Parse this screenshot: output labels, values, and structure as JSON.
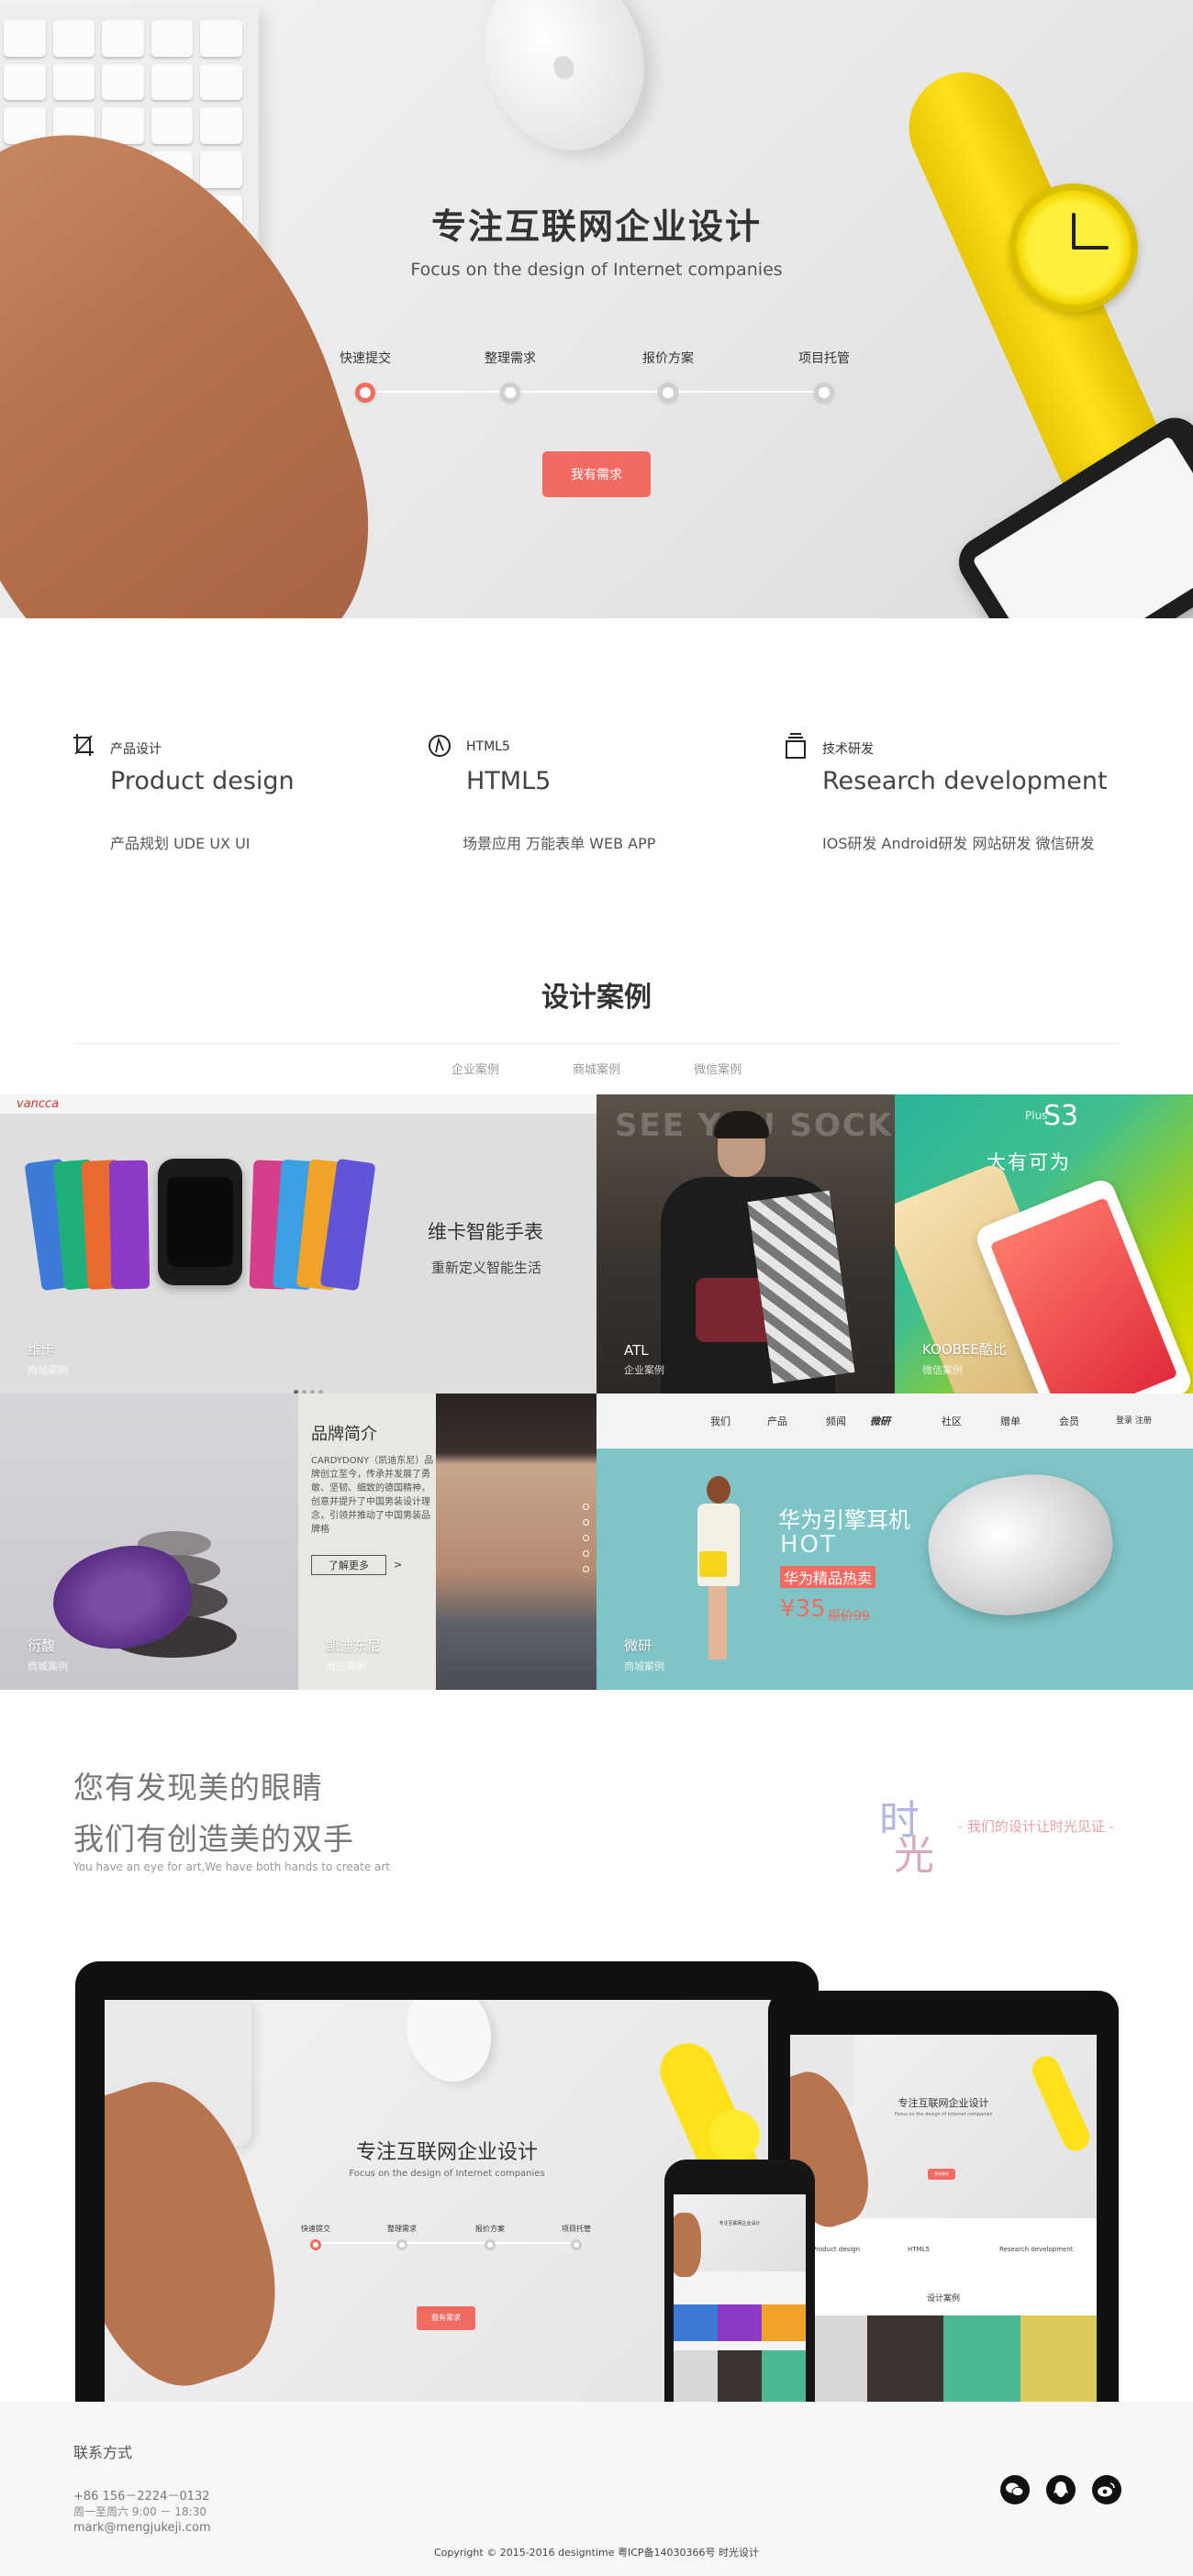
{
  "hero": {
    "title": "专注互联网企业设计",
    "subtitle": "Focus on the design of Internet companies",
    "steps": [
      "快速提交",
      "整理需求",
      "报价方案",
      "项目托管"
    ],
    "active_step": 1,
    "cta": "我有需求"
  },
  "services": [
    {
      "tag": "产品设计",
      "title": "Product design",
      "desc": "产品规划 UDE UX UI",
      "icon": "crop-icon"
    },
    {
      "tag": "HTML5",
      "title": "HTML5",
      "desc": "场景应用 万能表单 WEB APP",
      "icon": "compass-icon"
    },
    {
      "tag": "技术研发",
      "title": "Research development",
      "desc": "IOS研发 Android研发 网站研发 微信研发",
      "icon": "stack-icon"
    }
  ],
  "cases": {
    "title": "设计案例",
    "tabs": [
      "企业案例",
      "商城案例",
      "微信案例"
    ],
    "items": [
      {
        "name": "维卡",
        "category": "商城案例",
        "brand": "vancca",
        "headline": "维卡智能手表",
        "tagline": "重新定义智能生活"
      },
      {
        "name": "ATL",
        "category": "企业案例",
        "bg_text": "SEE YOU SOCK"
      },
      {
        "name": "KOOBEE酷比",
        "category": "微信案例",
        "plus": "Plus",
        "model": "S3",
        "slogan": "大有可为"
      },
      {
        "name": "衍馥",
        "category": "商城案例"
      },
      {
        "name": "凯迪东尼",
        "category": "微店案例",
        "intro_title": "品牌简介",
        "intro_text": "CARDYDONY（凯迪东尼）品牌创立至今，传承并发展了勇敢、坚韧、细致的德国精神，创意并提升了中国男装设计理念，引领并推动了中国男装品牌格",
        "more": "了解更多",
        "more_arrow": ">"
      },
      {
        "name": "微研",
        "category": "商城案例",
        "logo": "微研",
        "nav": [
          "我们",
          "产品",
          "频闻",
          "社区",
          "赠单",
          "会员",
          "登录 注册"
        ],
        "promo_title": "华为引擎耳机",
        "promo_hot": "HOT",
        "promo_sub": "华为精品热卖",
        "price": "¥35",
        "old_price": "原价99"
      }
    ]
  },
  "discover": {
    "line1": "您有发现美的眼睛",
    "line2": "我们有创造美的双手",
    "line3": "You have an eye for art,We have both hands to create art",
    "brand_c1": "时",
    "brand_c2": "光",
    "slogan": "- 我们的设计让时光见证 -"
  },
  "devices": {
    "title": "专注互联网企业设计",
    "subtitle": "Focus on the design of Internet companies",
    "steps": [
      "快速提交",
      "整理需求",
      "报价方案",
      "项目托管"
    ],
    "cta": "我有需求",
    "tablet_services": [
      "Product design",
      "HTML5",
      "Research development"
    ],
    "tablet_cases": "设计案例"
  },
  "footer": {
    "title": "联系方式",
    "phone": "+86 156－2224－0132",
    "hours": "周一至周六 9:00 － 18:30",
    "email": "mark@mengjukeji.com",
    "copyright": "Copyright © 2015-2016 designtime 粤ICP备14030366号 时光设计",
    "social": [
      "wechat-icon",
      "qq-icon",
      "weibo-icon"
    ]
  },
  "colors": {
    "accent": "#f26b63",
    "teal": "#2ab5a0",
    "watch_yellow": "#ffe11a"
  }
}
